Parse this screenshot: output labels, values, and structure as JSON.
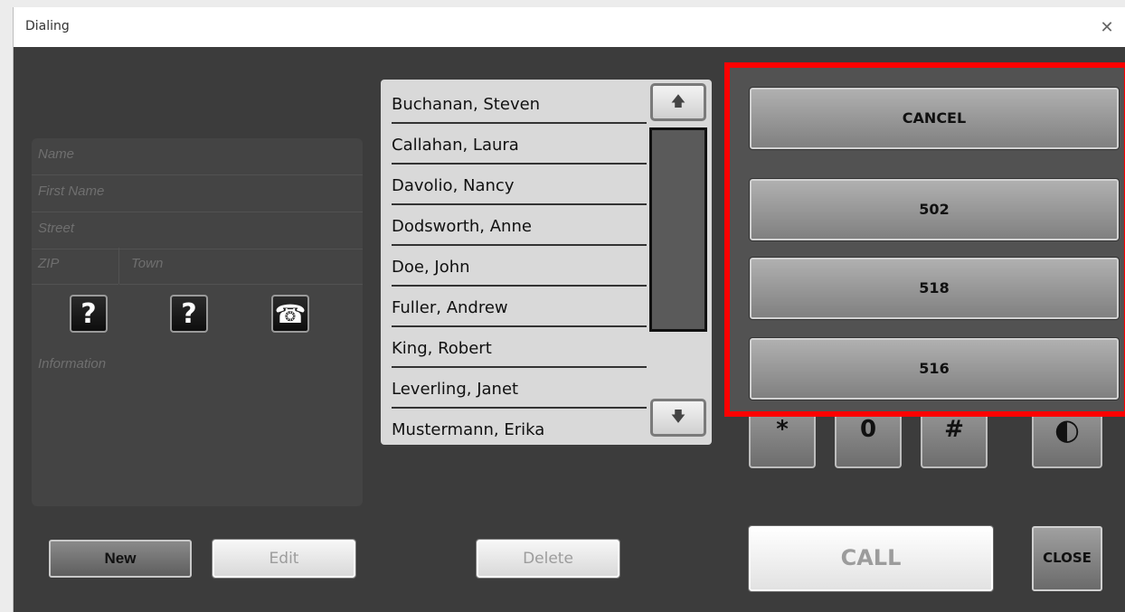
{
  "window": {
    "title": "Dialing",
    "close_glyph": "✕"
  },
  "details": {
    "name_placeholder": "Name",
    "first_name_placeholder": "First Name",
    "street_placeholder": "Street",
    "zip_placeholder": "ZIP",
    "town_placeholder": "Town",
    "information_placeholder": "Information",
    "lookup1_glyph": "?",
    "lookup2_glyph": "?",
    "phone_glyph": "☎"
  },
  "buttons": {
    "new": "New",
    "edit": "Edit",
    "delete": "Delete",
    "call": "CALL",
    "close": "CLOSE"
  },
  "contacts": [
    "Buchanan, Steven",
    "Callahan, Laura",
    "Davolio, Nancy",
    "Dodsworth, Anne",
    "Doe, John",
    "Fuller, Andrew",
    "King, Robert",
    "Leverling, Janet",
    "Mustermann, Erika"
  ],
  "scroll": {
    "up_glyph": "🡅",
    "down_glyph": "🡇"
  },
  "numbers_panel": {
    "cancel": "CANCEL",
    "numbers": [
      "502",
      "518",
      "516"
    ]
  },
  "keypad": {
    "star": "*",
    "zero": "0",
    "hash": "#",
    "toggle_glyph": "◐"
  },
  "colors": {
    "window_bg": "#3c3c3c",
    "highlight": "#ff0000",
    "list_bg": "#d9d9d9"
  }
}
